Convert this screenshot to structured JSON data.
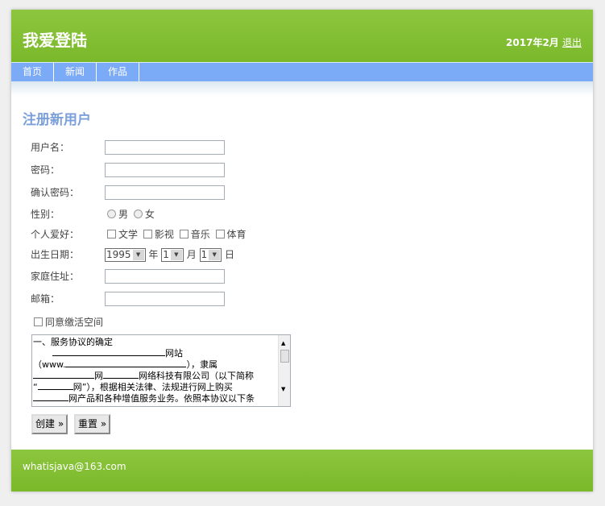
{
  "header": {
    "title": "我爱登陆",
    "date": "2017年2月",
    "logout": "退出"
  },
  "nav": {
    "items": [
      "首页",
      "新闻",
      "作品"
    ]
  },
  "form": {
    "title": "注册新用户",
    "username_label": "用户名：",
    "password_label": "密码：",
    "confirm_label": "确认密码：",
    "gender_label": "性别：",
    "gender_options": [
      "男",
      "女"
    ],
    "hobby_label": "个人爱好：",
    "hobbies": [
      "文学",
      "影视",
      "音乐",
      "体育"
    ],
    "birth_label": "出生日期：",
    "birth_year": "1995",
    "year_unit": "年",
    "birth_month": "1",
    "month_unit": "月",
    "birth_day": "1",
    "day_unit": "日",
    "address_label": "家庭住址：",
    "email_label": "邮箱：",
    "agree_label": "同意缴活空间",
    "agreement_lines": [
      "一、服务协议的确定",
      "网站",
      "（www.",
      "），隶属",
      "网",
      "网络科技有限公司（以下简称",
      "“",
      "网”），根据相关法律、法规进行网上购买",
      "网产品和各种增值服务业务。依照本协议以下条"
    ],
    "create_button": "创建 »",
    "reset_button": "重置 »"
  },
  "footer": {
    "email": "whatisjava@163.com"
  }
}
